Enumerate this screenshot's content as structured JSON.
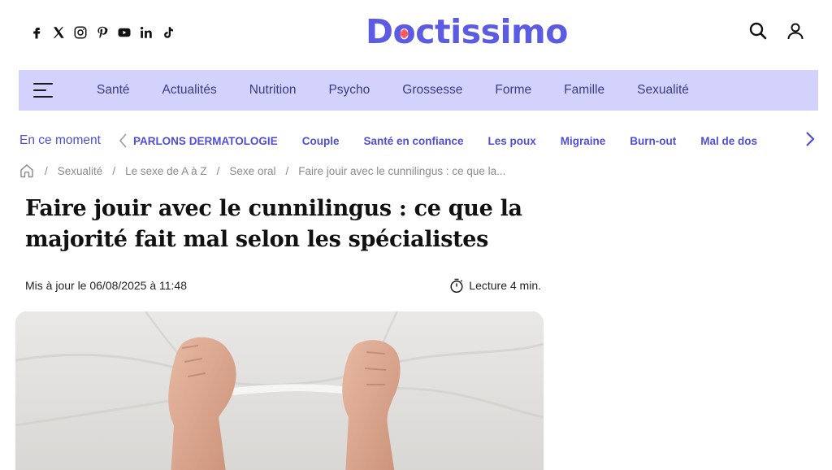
{
  "brand": {
    "name_prefix": "D",
    "name_o": "o",
    "name_suffix": "ctissimo",
    "color": "#5b5ce2"
  },
  "socials": [
    "facebook-icon",
    "x-icon",
    "instagram-icon",
    "pinterest-icon",
    "youtube-icon",
    "linkedin-icon",
    "tiktok-icon"
  ],
  "header_actions": [
    "search-icon",
    "user-icon"
  ],
  "nav": {
    "items": [
      "Santé",
      "Actualités",
      "Nutrition",
      "Psycho",
      "Grossesse",
      "Forme",
      "Famille",
      "Sexualité"
    ]
  },
  "moment": {
    "label": "En ce moment",
    "items": [
      "PARLONS DERMATOLOGIE",
      "Couple",
      "Santé en confiance",
      "Les poux",
      "Migraine",
      "Burn-out",
      "Mal de dos"
    ]
  },
  "breadcrumb": {
    "items": [
      "Sexualité",
      "Le sexe de A à Z",
      "Sexe oral",
      "Faire jouir avec le cunnilingus : ce que la..."
    ]
  },
  "article": {
    "title": "Faire jouir avec le cunnilingus : ce que la majorité fait mal selon les spécialistes",
    "updated": "Mis à jour le 06/08/2025 à 11:48",
    "read_time": "Lecture 4 min."
  },
  "colors": {
    "nav_bg": "#d3d2fd",
    "accent": "#4f4fd6"
  }
}
